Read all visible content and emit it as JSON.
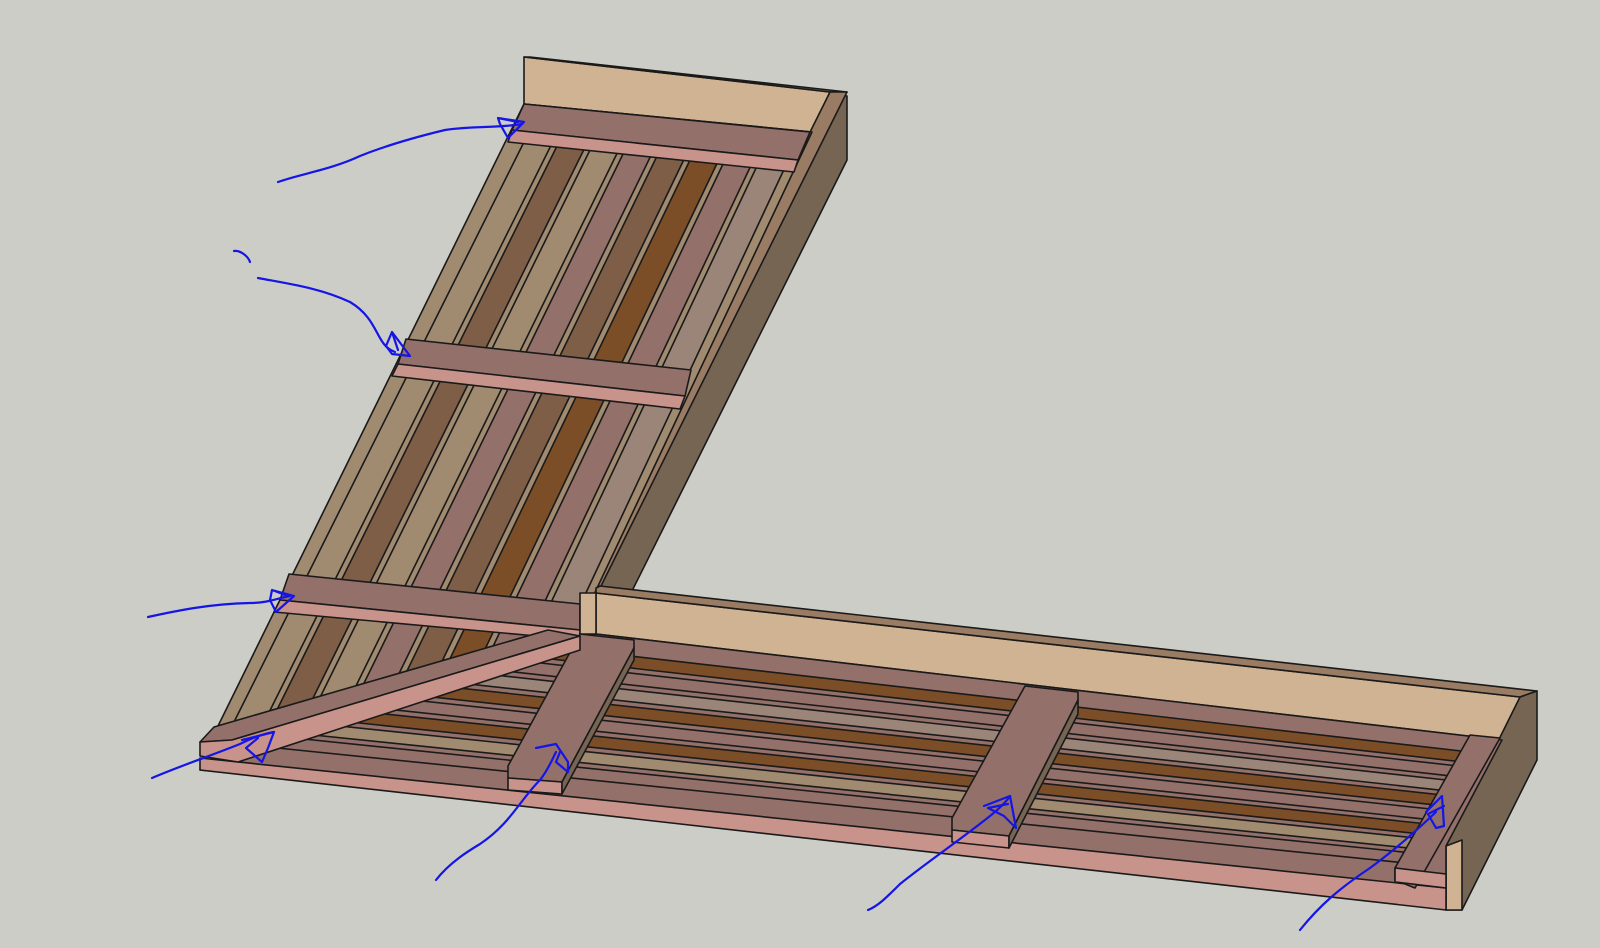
{
  "scene": {
    "description_free": true,
    "background_color": "#cdcdc8",
    "wood_colors": {
      "top_board_face": "#d0b392",
      "top_board_cap": "#9a7b63",
      "end_face": "#776553",
      "cleat": "#94706a",
      "cleat_edge": "#c8938a",
      "slat_tan": "#a08a70",
      "slat_dark": "#7e5e47",
      "slat_mauve": "#94706a",
      "slat_brown": "#7b4e28",
      "slat_grey": "#9a8578"
    },
    "ink_color": "#1515e6",
    "arrow_count": 7
  }
}
